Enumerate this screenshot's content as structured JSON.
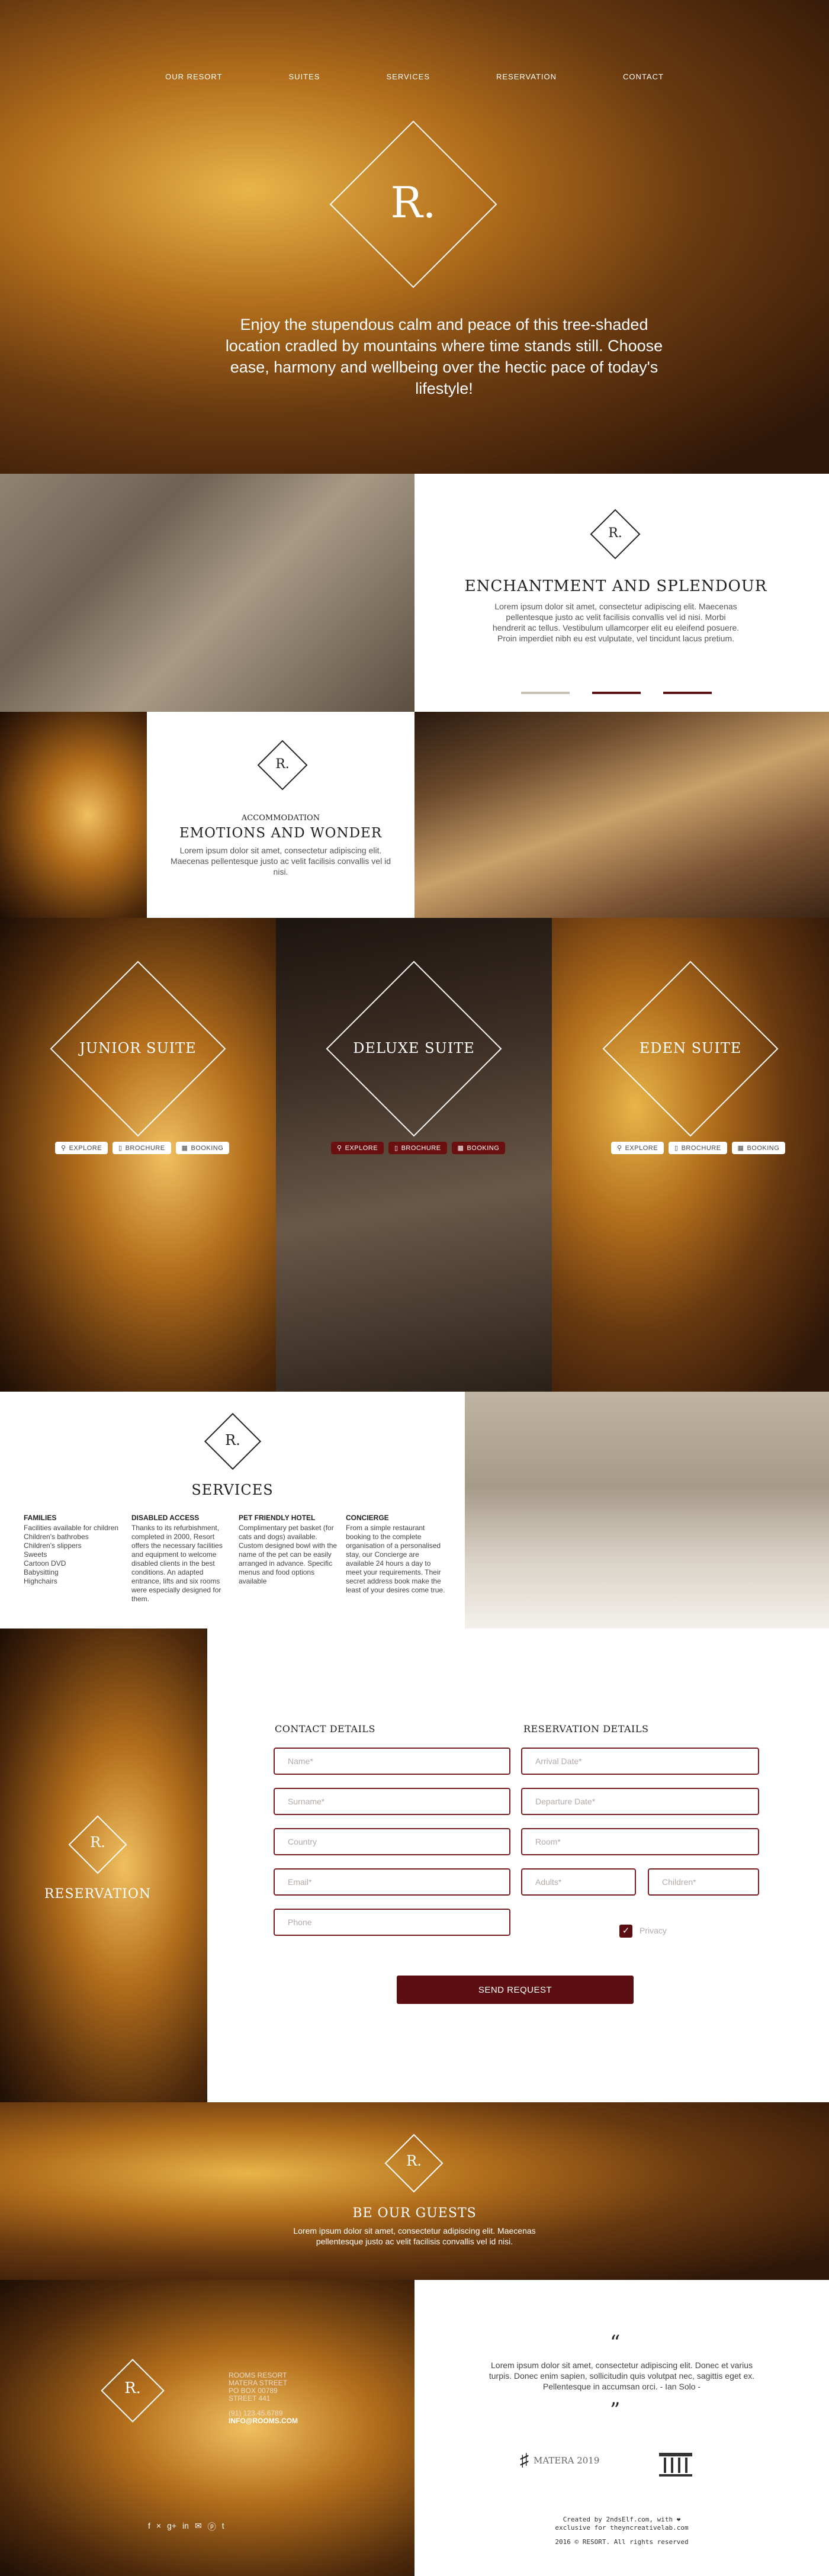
{
  "nav": {
    "items": [
      "OUR RESORT",
      "SUITES",
      "SERVICES",
      "RESERVATION",
      "CONTACT"
    ]
  },
  "brand": {
    "logo_letter": "R."
  },
  "hero": {
    "text": "Enjoy the stupendous calm and peace of this tree-shaded location cradled by mountains where time stands still. Choose ease, harmony and wellbeing over the hectic pace of today's lifestyle!"
  },
  "enchantment": {
    "title": "ENCHANTMENT AND SPLENDOUR",
    "text": "Lorem ipsum dolor sit amet, consectetur adipiscing elit. Maecenas pellentesque justo ac velit facilisis convallis vel id nisi. Morbi hendrerit ac tellus. Vestibulum ullamcorper elit eu eleifend posuere. Proin imperdiet nibh eu est vulputate, vel tincidunt lacus pretium.",
    "slider_active_index": 1
  },
  "accommodation": {
    "label": "ACCOMMODATION",
    "title": "EMOTIONS AND WONDER",
    "text": "Lorem ipsum dolor sit amet, consectetur adipiscing elit. Maecenas pellentesque justo ac velit facilisis convallis vel id nisi."
  },
  "suites": [
    {
      "name": "JUNIOR SUITE",
      "explore": "EXPLORE",
      "brochure": "BROCHURE",
      "booking": "BOOKING"
    },
    {
      "name": "DELUXE SUITE",
      "explore": "EXPLORE",
      "brochure": "BROCHURE",
      "booking": "BOOKING"
    },
    {
      "name": "EDEN SUITE",
      "explore": "EXPLORE",
      "brochure": "BROCHURE",
      "booking": "BOOKING"
    }
  ],
  "services": {
    "title": "SERVICES",
    "columns": [
      {
        "heading": "FAMILIES",
        "text": "Facilities available for children\nChildren's bathrobes\nChildren's slippers\nSweets\nCartoon DVD\nBabysitting\nHighchairs"
      },
      {
        "heading": "DISABLED ACCESS",
        "text": "Thanks to its refurbishment, completed in 2000, Resort offers the necessary facilities and equipment to welcome disabled clients in the best conditions. An adapted entrance, lifts and six rooms were especially designed for them."
      },
      {
        "heading": "PET FRIENDLY HOTEL",
        "text": "Complimentary pet basket (for cats and dogs) available. Custom designed bowl with the name of the pet can be easily arranged in advance. Specific menus and food options available"
      },
      {
        "heading": "CONCIERGE",
        "text": "From a simple restaurant booking to the complete organisation of a personalised stay, our Concierge are available 24 hours a day to meet your requirements. Their secret address book make the least of your desires come true."
      }
    ]
  },
  "reservation": {
    "side_title": "RESERVATION",
    "contact_heading": "CONTACT DETAILS",
    "details_heading": "RESERVATION DETAILS",
    "placeholders": {
      "name": "Name*",
      "surname": "Surname*",
      "country": "Country",
      "email": "Email*",
      "phone": "Phone",
      "arrival": "Arrival Date*",
      "departure": "Departure Date*",
      "room": "Room*",
      "adults": "Adults*",
      "children": "Children*"
    },
    "privacy_label": "Privacy",
    "privacy_checked": true,
    "send_label": "SEND REQUEST"
  },
  "guests": {
    "title": "BE OUR GUESTS",
    "text": "Lorem ipsum dolor sit amet, consectetur adipiscing elit. Maecenas pellentesque justo ac velit facilisis convallis vel id nisi."
  },
  "footer": {
    "address": [
      "ROOMS RESORT",
      "MATERA STREET",
      "PO BOX 00789",
      "STREET 441"
    ],
    "phone": "(91) 123.45.6789",
    "email": "INFO@ROOMS.COM",
    "social_icons": [
      "facebook-icon",
      "twitter-icon",
      "googleplus-icon",
      "linkedin-icon",
      "email-icon",
      "pinterest-icon",
      "tumblr-icon"
    ],
    "social_glyphs": [
      "f",
      "×",
      "g+",
      "in",
      "✉",
      "ⓟ",
      "t"
    ],
    "quote": "Lorem ipsum dolor sit amet, consectetur adipiscing elit. Donec et varius turpis. Donec enim sapien, sollicitudin quis volutpat nec, sagittis eget ex. Pellentesque in accumsan orci. - Ian Solo -",
    "partner_matera": "MATERA 2019",
    "credits_line1": "Created by 2ndsElf.com, with ❤",
    "credits_line2": "exclusive for theyncreativelab.com",
    "copyright": "2016 © RESORT. All rights reserved"
  }
}
